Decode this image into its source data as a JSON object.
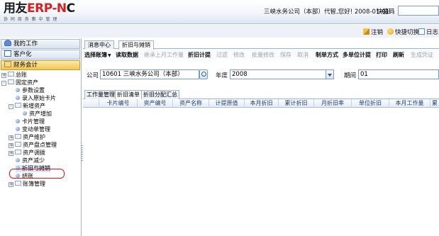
{
  "banner": {
    "logo_main_black": "用友",
    "logo_main_red": "ERP-N",
    "logo_main_black2": "C",
    "logo_sub": "协 同 商 务    集 中 管 理",
    "info": "三峡水务公司（本部）代智,您好! 2008-01-01",
    "quick_code_label": "快捷码",
    "quick_code_value": ""
  },
  "utility": {
    "logout": "注销",
    "switch": "快捷切换",
    "log": "日志"
  },
  "left_panel": {
    "headers": [
      {
        "label": "我的工作",
        "icon": "my-work-icon"
      },
      {
        "label": "客户化",
        "icon": "customize-icon"
      },
      {
        "label": "财务会计",
        "icon": "finance-icon"
      }
    ],
    "tree": [
      {
        "label": "总账",
        "type": "folder",
        "toggle": "+"
      },
      {
        "label": "固定资产",
        "type": "folder",
        "toggle": "-"
      },
      {
        "label": "参数设置",
        "type": "leaf"
      },
      {
        "label": "录入原始卡片",
        "type": "leaf"
      },
      {
        "label": "新增资产",
        "type": "folder",
        "toggle": "-"
      },
      {
        "label": "资产增加",
        "type": "leaf"
      },
      {
        "label": "卡片管理",
        "type": "leaf"
      },
      {
        "label": "变动单管理",
        "type": "leaf"
      },
      {
        "label": "资产维护",
        "type": "folder",
        "toggle": "+"
      },
      {
        "label": "资产盘点管理",
        "type": "folder",
        "toggle": "+"
      },
      {
        "label": "资产调拨",
        "type": "folder",
        "toggle": "+"
      },
      {
        "label": "资产减少",
        "type": "leaf"
      },
      {
        "label": "折旧与摊销",
        "type": "leaf"
      },
      {
        "label": "结账",
        "type": "leaf"
      },
      {
        "label": "账簿管理",
        "type": "folder",
        "toggle": "+"
      }
    ]
  },
  "tabs": [
    "消息中心",
    "折旧与摊销"
  ],
  "toolbar": [
    {
      "label": "选择账簿",
      "enabled": true,
      "dropdown": true
    },
    {
      "label": "读取数据",
      "enabled": true
    },
    {
      "label": "继承上月工作量",
      "enabled": false
    },
    {
      "label": "折旧计提",
      "enabled": true
    },
    {
      "label": "过滤",
      "enabled": false
    },
    {
      "label": "修改",
      "enabled": false
    },
    {
      "label": "批量修改",
      "enabled": false
    },
    {
      "label": "保存",
      "enabled": false
    },
    {
      "label": "取消",
      "enabled": false
    },
    {
      "label": "制单方式",
      "enabled": true
    },
    {
      "label": "多单位计提",
      "enabled": true
    },
    {
      "label": "打印",
      "enabled": true
    },
    {
      "label": "刷新",
      "enabled": true
    },
    {
      "label": "生成凭证",
      "enabled": false
    }
  ],
  "filter": {
    "company_label": "公司",
    "company_value": "10601 三峡水务公司（本部）",
    "year_label": "年度",
    "year_value": "2008",
    "period_label": "期间",
    "period_value": "01"
  },
  "subtabs": [
    "工作量管理",
    "折旧清单",
    "折旧分配汇总"
  ],
  "grid_columns": [
    "卡片编号",
    "资产编号",
    "资产名称",
    "计提原值",
    "本月折旧",
    "累计折旧",
    "月折旧率",
    "单位折旧",
    "本月工作量",
    "累"
  ],
  "colors": {
    "accent_blue": "#1c3f7a",
    "highlight_red": "#e0141c",
    "logo_red": "#d81e1e"
  }
}
